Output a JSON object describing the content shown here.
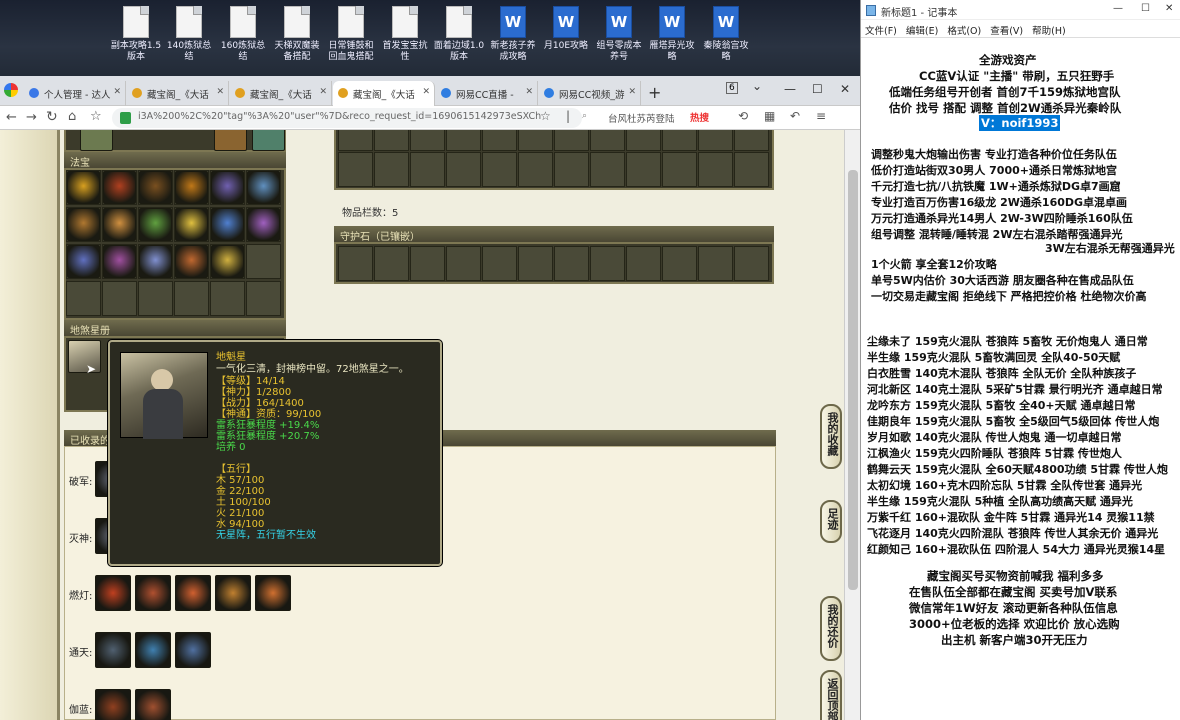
{
  "desktop": {
    "icons": [
      {
        "label": "副本攻略1.5版本",
        "type": "doc"
      },
      {
        "label": "140炼狱总结",
        "type": "doc"
      },
      {
        "label": "160炼狱总结",
        "type": "doc"
      },
      {
        "label": "天梯双魔装备搭配",
        "type": "doc"
      },
      {
        "label": "日常锤鼓和回血鬼搭配",
        "type": "doc"
      },
      {
        "label": "首发宝宝抗性",
        "type": "doc"
      },
      {
        "label": "面着边域1.0版本",
        "type": "doc"
      },
      {
        "label": "新老孩子养成攻略",
        "type": "word"
      },
      {
        "label": "月10E攻略",
        "type": "word"
      },
      {
        "label": "组号零成本养号",
        "type": "word"
      },
      {
        "label": "雁塔异光攻略",
        "type": "word"
      },
      {
        "label": "秦陵翁宫攻略",
        "type": "word"
      }
    ]
  },
  "browser": {
    "tabs": [
      {
        "label": "个人管理 - 达人",
        "color": "#3b78e7"
      },
      {
        "label": "藏宝阁_《大话",
        "color": "#e0a020"
      },
      {
        "label": "藏宝阁_《大话",
        "color": "#e0a020"
      },
      {
        "label": "藏宝阁_《大话",
        "color": "#e0a020",
        "active": true
      },
      {
        "label": "网易CC直播 -",
        "color": "#2f7de1"
      },
      {
        "label": "网易CC视频_游",
        "color": "#2f7de1"
      }
    ],
    "tab_count": "6",
    "url": "i3A%200%2C%20\"tag\"%3A%20\"user\"%7D&reco_request_id=1690615142973eSXCh",
    "search_hint": "台风杜苏芮登陆",
    "hot_label": "热搜"
  },
  "game": {
    "fabao_title": "法宝",
    "dishasheng_title": "地煞星册",
    "item_count_text": "物品栏数：5",
    "guardian_title": "守护石（已镶嵌）",
    "collected_title": "已收录的",
    "rows": [
      {
        "label": "破军:"
      },
      {
        "label": "灭神:"
      },
      {
        "label": "燃灯:"
      },
      {
        "label": "通天:"
      },
      {
        "label": "伽蓝:"
      }
    ],
    "fabao_colors": [
      "#d8a020",
      "#b04020",
      "#7a5020",
      "#c07818",
      "#7060b0",
      "#6090c0",
      "#b07830",
      "#d09040",
      "#60a040",
      "#e0c040",
      "#5080d0",
      "#a060c0",
      "#6070c0",
      "#a050a0",
      "#8090d0",
      "#c06830",
      "#d0b040"
    ],
    "collected_colors": [
      [
        "#c04020",
        "#b05030",
        "#d06030",
        "#c08030",
        "#d07030"
      ],
      [
        "#506070",
        "#4080b0",
        "#5070a0"
      ],
      [
        "#904020",
        "#a05030"
      ]
    ]
  },
  "tooltip": {
    "name": "地魁星",
    "desc": "一气化三清，封神榜中留。72地煞星之一。",
    "level": "【等级】14/14",
    "shenli": "【神力】1/2800",
    "zhanli": "【战力】164/1400",
    "shentong": "【神通】资质：99/100",
    "lei1": "雷系狂暴程度 +19.4%",
    "lei2": "雷系狂暴程度 +20.7%",
    "peiyang": "培养 0",
    "wuxing_title": "【五行】",
    "mu": "木 57/100",
    "jin": "金 22/100",
    "tu": "土 100/100",
    "huo": "火 21/100",
    "shui": "水 94/100",
    "note": "无星阵，五行暂不生效"
  },
  "side_buttons": [
    "我的收藏",
    "足迹",
    "我的还价",
    "返回顶部"
  ],
  "notepad": {
    "title": "新标题1 - 记事本",
    "menu": [
      "文件(F)",
      "编辑(E)",
      "格式(O)",
      "查看(V)",
      "帮助(H)"
    ],
    "lines": [
      "全游戏资产",
      "CC蓝V认证 \"主播\" 带刷，五只狂野手",
      "低端任务组号开创者          首创7千159炼狱地宫队",
      "估价 找号 搭配 调整          首创2W通杀异光秦岭队",
      "V：noif1993",
      "调整秒鬼大炮输出伤害           专业打造各种价位任务队伍",
      "低价打造站街双30男人            7000+通杀日常炼狱地宫",
      "千元打造七抗/八抗铁魔           1W+通杀炼狱DG卓7画窟",
      "专业打造百万伤害16级龙          2W通杀160DG卓混卓画",
      "万元打造通杀异光14男人          2W-3W四阶睡杀160队伍",
      "组号调整 混转睡/睡转混           2W左右混杀踏帮强通异光",
      "3W左右混杀无帮强通异光",
      "1个火箭 享全套12价攻略",
      "单号5W内估价 30大话西游          朋友圈各种在售成品队伍",
      "一切交易走藏宝阁 拒绝线下     严格把控价格 杜绝物次价高",
      "尘缘未了 159克火混队 苍狼阵 5畜牧 无价炮鬼人 通日常",
      "半生缘    159克火混队 5畜牧满回灵 全队40-50天赋",
      "白衣胜雪 140克木混队 苍狼阵 全队无价 全队种族孩子",
      "河北新区 140克土混队 5采矿5甘霖 景行明光齐 通卓越日常",
      "龙吟东方 159克火混队 5畜牧 全40+天赋 通卓越日常",
      "佳期良年 159克火混队 5畜牧 全5级回气5级回体 传世人炮",
      "岁月如歌 140克火混队 传世人炮鬼 通一切卓越日常",
      "江枫渔火 159克火四阶睡队 苍狼阵 5甘霖 传世炮人",
      "鹤舞云天 159克火混队 全60天赋4800功绩 5甘霖 传世人炮",
      "太初幻境 160+克木四阶忘队 5甘霖 全队传世套 通异光",
      "半生缘    159克火混队 5种植 全队高功绩高天赋 通异光",
      "万紫千红 160+混砍队 金牛阵 5甘霖 通异光14 灵猴11禁",
      "飞花逐月 140克火四阶混队 苍狼阵 传世人其余无价 通异光",
      "红颜知己 160+混砍队伍 四阶混人 54大力 通异光灵猴14星",
      "藏宝阁买号买物资前喊我 福利多多",
      "在售队伍全部都在藏宝阁 买卖号加V联系",
      "微信常年1W好友 滚动更新各种队伍信息",
      "3000+位老板的选择 欢迎比价 放心选购",
      "出主机 新客户端30开无压力"
    ]
  }
}
